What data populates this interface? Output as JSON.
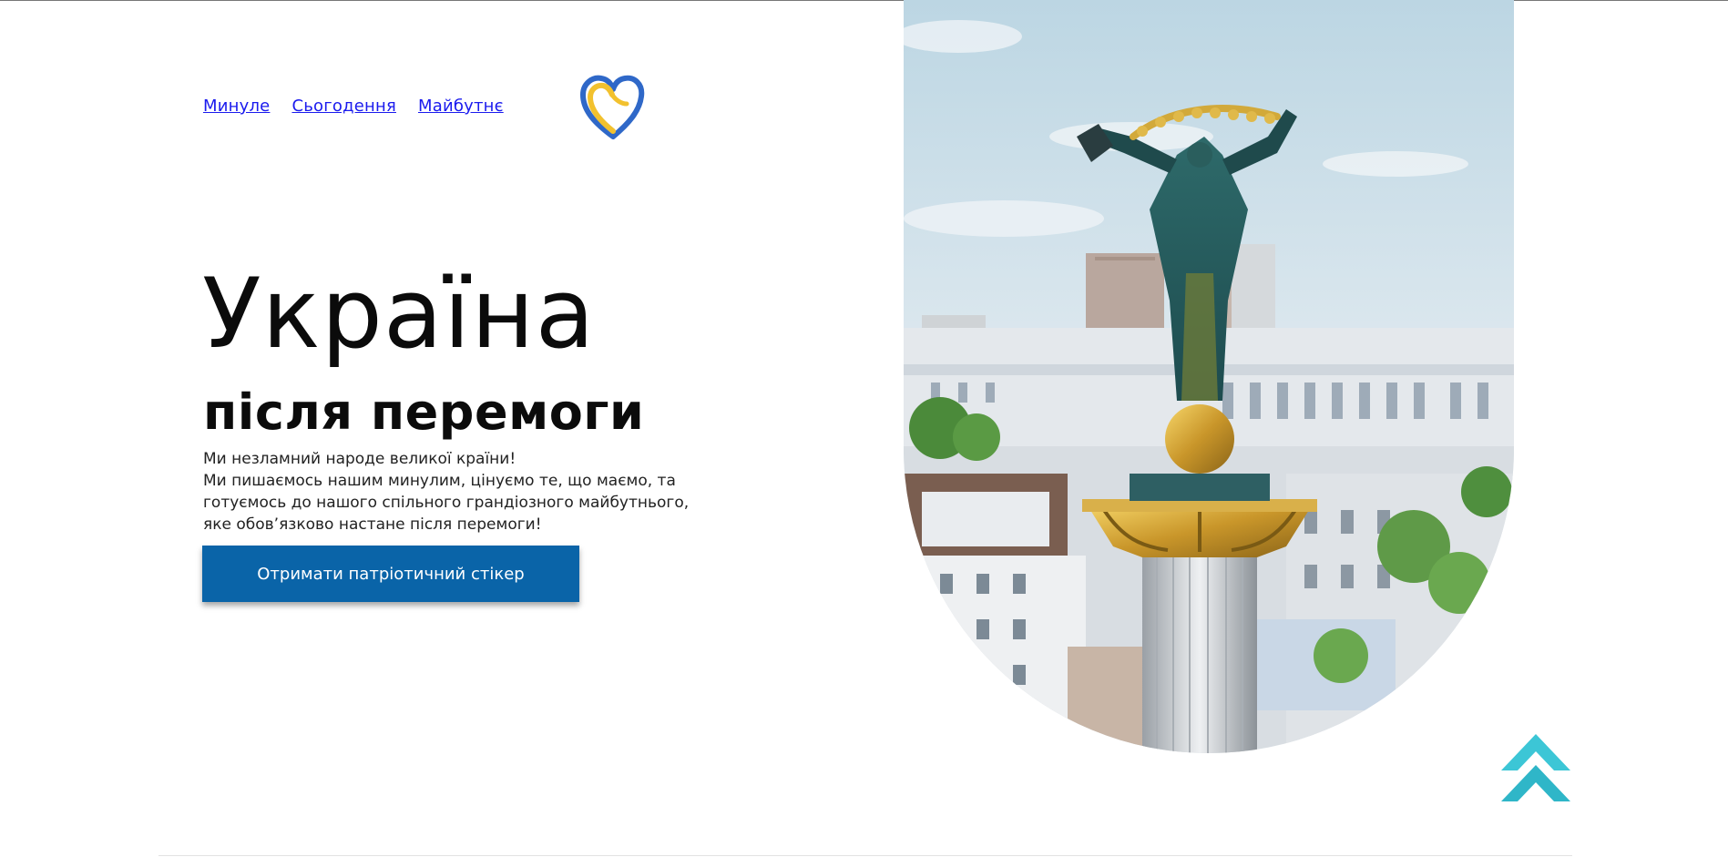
{
  "nav": {
    "items": [
      {
        "label": "Минуле"
      },
      {
        "label": "Сьогодення"
      },
      {
        "label": "Майбутнє"
      }
    ]
  },
  "hero": {
    "title": "Україна",
    "subtitle": "після перемоги",
    "text_lines": [
      "Ми незламний народе великої країни!",
      "Ми пишаємось нашим минулим, цінуємо те, що маємо, та готуємось до нашого спільного грандіозного майбутнього, яке обов’язково настане після перемоги!"
    ],
    "cta_label": "Отримати патріотичний стікер"
  },
  "icons": {
    "logo": "heart-logo-icon",
    "scroll_top": "chevrons-up-icon"
  },
  "colors": {
    "link": "#1a1aee",
    "cta_bg": "#0a64a8",
    "heart_blue": "#2f68c8",
    "heart_yellow": "#f2c12e",
    "scroll_top": "#3cc6d6"
  }
}
